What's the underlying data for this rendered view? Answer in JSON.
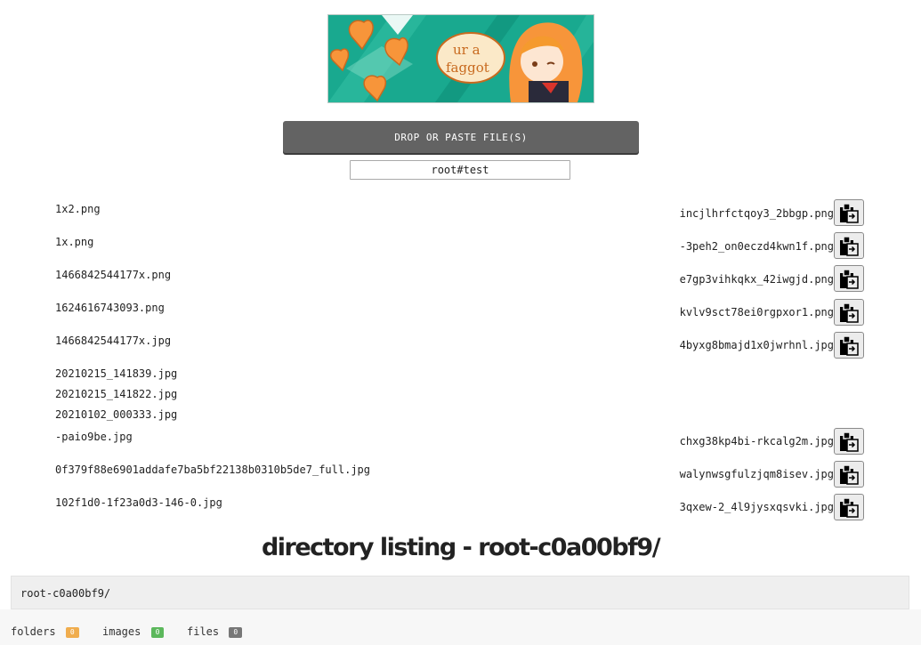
{
  "banner": {
    "text_line1": "ur a",
    "text_line2": "faggot"
  },
  "upload": {
    "drop_label": "DROP OR PASTE FILE(S)",
    "password_value": "root#test"
  },
  "files": [
    {
      "name": "1x2.png",
      "link": "incjlhrfctqoy3_2bbgp.png"
    },
    {
      "name": "1x.png",
      "link": "-3peh2_on0eczd4kwn1f.png"
    },
    {
      "name": "1466842544177x.png",
      "link": "e7gp3vihkqkx_42iwgjd.png"
    },
    {
      "name": "1624616743093.png",
      "link": "kvlv9sct78ei0rgpxor1.png"
    },
    {
      "name": "1466842544177x.jpg",
      "link": "4byxg8bmajd1x0jwrhnl.jpg"
    },
    {
      "name": "20210215_141839.jpg",
      "link": ""
    },
    {
      "name": "20210215_141822.jpg",
      "link": ""
    },
    {
      "name": "20210102_000333.jpg",
      "link": ""
    },
    {
      "name": "-paio9be.jpg",
      "link": "chxg38kp4bi-rkcalg2m.jpg"
    },
    {
      "name": "0f379f88e6901addafe7ba5bf22138b0310b5de7_full.jpg",
      "link": "walynwsgfulzjqm8isev.jpg"
    },
    {
      "name": "102f1d0-1f23a0d3-146-0.jpg",
      "link": "3qxew-2_4l9jysxqsvki.jpg"
    }
  ],
  "listing": {
    "title": "directory listing - root-c0a00bf9/",
    "path": "root-c0a00bf9/"
  },
  "stats": {
    "folders_label": "folders",
    "folders_count": "0",
    "images_label": "images",
    "images_count": "0",
    "files_label": "files",
    "files_count": "0"
  },
  "colors": {
    "drop_button": "#636363",
    "folders_badge": "#f0ad4e",
    "images_badge": "#5cb85c",
    "files_badge": "#777777",
    "banner_teal": "#19a98f",
    "banner_orange": "#f7953a"
  },
  "icons": {
    "copy": "clipboard-paste-icon"
  }
}
